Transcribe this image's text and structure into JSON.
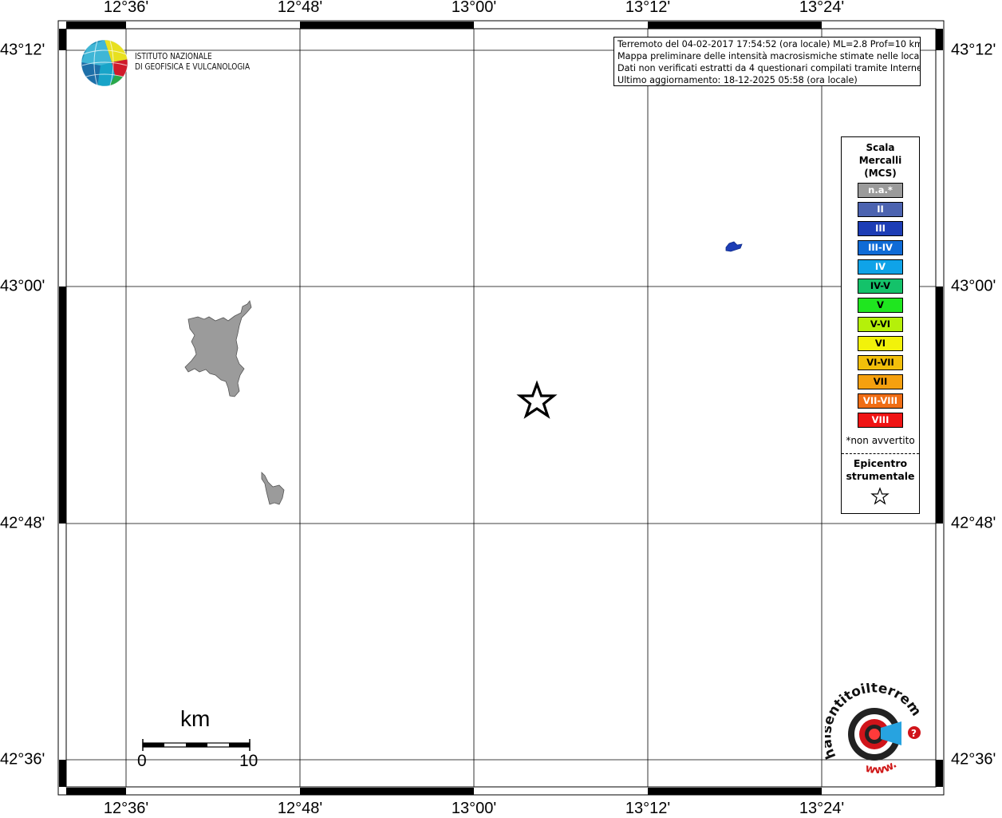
{
  "map": {
    "lon_labels": [
      "12°36'",
      "12°48'",
      "13°00'",
      "13°12'",
      "13°24'"
    ],
    "lat_labels": [
      "43°12'",
      "43°00'",
      "42°48'",
      "42°36'"
    ]
  },
  "header": {
    "lines": [
      "Terremoto del 04-02-2017 17:54:52 (ora locale) ML=2.8 Prof=10 km",
      "Mappa preliminare delle intensità macrosismiche stimate nelle località",
      "Dati non verificati estratti da 4 questionari compilati tramite Internet.",
      "Ultimo aggiornamento: 18-12-2025 05:58 (ora locale)"
    ]
  },
  "logo": {
    "line1": "ISTITUTO NAZIONALE",
    "line2": "DI GEOFISICA E VULCANOLOGIA",
    "icon": "ingv-globe-icon"
  },
  "legend": {
    "title1": "Scala",
    "title2": "Mercalli",
    "title3": "(MCS)",
    "items": [
      {
        "label": "n.a.*",
        "color": "#9b9b9b"
      },
      {
        "label": "II",
        "color": "#4c63b0"
      },
      {
        "label": "III",
        "color": "#1d3db5"
      },
      {
        "label": "III-IV",
        "color": "#0f6bd6"
      },
      {
        "label": "IV",
        "color": "#0fa3e8"
      },
      {
        "label": "IV-V",
        "color": "#14c26a"
      },
      {
        "label": "V",
        "color": "#1fe61f"
      },
      {
        "label": "V-VI",
        "color": "#b5f00a"
      },
      {
        "label": "VI",
        "color": "#f2f20a"
      },
      {
        "label": "VI-VII",
        "color": "#f2bf0a"
      },
      {
        "label": "VII",
        "color": "#f5a00f"
      },
      {
        "label": "VII-VIII",
        "color": "#f06d14"
      },
      {
        "label": "VIII",
        "color": "#f01414"
      }
    ],
    "note": "*non avvertito",
    "epicenter1": "Epicentro",
    "epicenter2": "strumentale",
    "epicenter_icon": "star-icon"
  },
  "scalebar": {
    "unit": "km",
    "label_start": "0",
    "label_end": "10"
  },
  "hst_logo": {
    "text": "haisentitoilterremoto.it",
    "www": "www.",
    "icon": "seismic-target-icon"
  }
}
